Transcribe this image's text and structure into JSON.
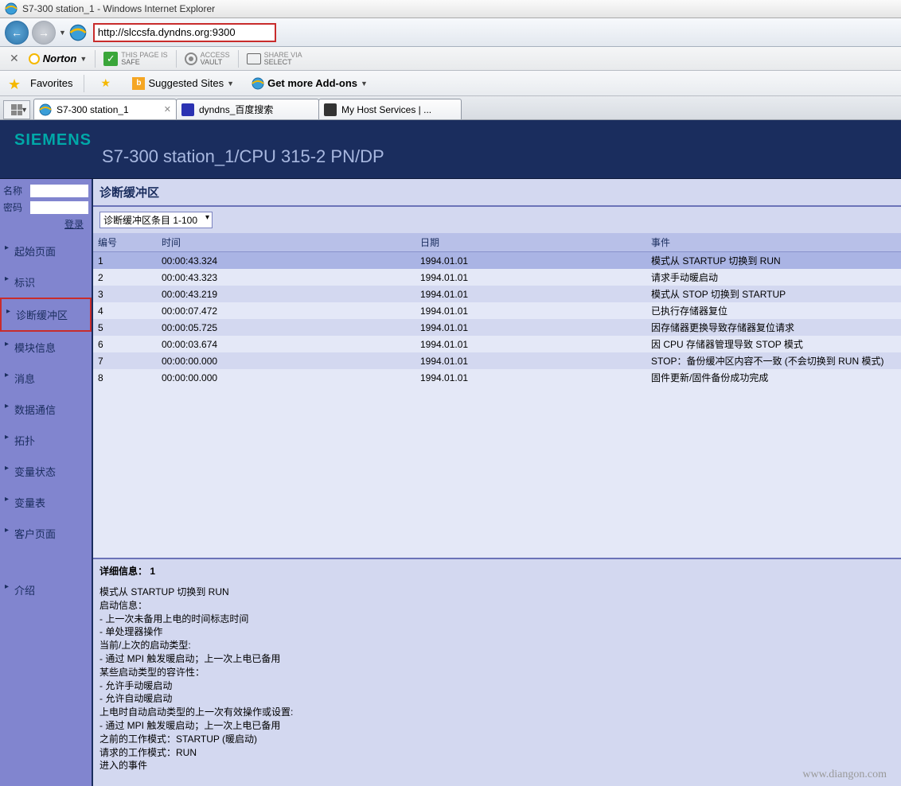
{
  "window": {
    "title": "S7-300 station_1 - Windows Internet Explorer"
  },
  "nav": {
    "url": "http://slccsfa.dyndns.org:9300"
  },
  "norton": {
    "brand": "Norton",
    "safe1": "THIS PAGE IS",
    "safe2": "SAFE",
    "vault1": "ACCESS",
    "vault2": "VAULT",
    "share1": "SHARE VIA",
    "share2": "SELECT"
  },
  "favbar": {
    "favorites": "Favorites",
    "suggested": "Suggested Sites",
    "addons": "Get more Add-ons"
  },
  "tabs": {
    "t1": "S7-300 station_1",
    "t2": "dyndns_百度搜索",
    "t3": "My Host Services | ..."
  },
  "siemens": {
    "logo": "SIEMENS",
    "station": "S7-300 station_1/CPU 315-2 PN/DP"
  },
  "login": {
    "name_label": "名称",
    "pw_label": "密码",
    "login_link": "登录"
  },
  "navitems": {
    "n0": "起始页面",
    "n1": "标识",
    "n2": "诊断缓冲区",
    "n3": "模块信息",
    "n4": "消息",
    "n5": "数据通信",
    "n6": "拓扑",
    "n7": "变量状态",
    "n8": "变量表",
    "n9": "客户页面",
    "n10": "介绍"
  },
  "panel": {
    "title": "诊断缓冲区",
    "dropdown": "诊断缓冲区条目 1-100",
    "col_num": "编号",
    "col_time": "时间",
    "col_date": "日期",
    "col_event": "事件",
    "details_label": "详细信息：   1"
  },
  "rows": [
    {
      "n": "1",
      "t": "00:00:43.324",
      "d": "1994.01.01",
      "e": "模式从 STARTUP 切换到 RUN"
    },
    {
      "n": "2",
      "t": "00:00:43.323",
      "d": "1994.01.01",
      "e": "请求手动暖启动"
    },
    {
      "n": "3",
      "t": "00:00:43.219",
      "d": "1994.01.01",
      "e": "模式从 STOP 切换到 STARTUP"
    },
    {
      "n": "4",
      "t": "00:00:07.472",
      "d": "1994.01.01",
      "e": "已执行存储器复位"
    },
    {
      "n": "5",
      "t": "00:00:05.725",
      "d": "1994.01.01",
      "e": "因存储器更换导致存储器复位请求"
    },
    {
      "n": "6",
      "t": "00:00:03.674",
      "d": "1994.01.01",
      "e": "因 CPU 存储器管理导致 STOP 模式"
    },
    {
      "n": "7",
      "t": "00:00:00.000",
      "d": "1994.01.01",
      "e": "STOP：备份缓冲区内容不一致 (不会切换到 RUN 模式)"
    },
    {
      "n": "8",
      "t": "00:00:00.000",
      "d": "1994.01.01",
      "e": "固件更新/固件备份成功完成"
    }
  ],
  "details": "模式从 STARTUP 切换到 RUN\n启动信息：\n- 上一次未备用上电的时间标志时间\n- 单处理器操作\n当前/上次的启动类型:\n- 通过 MPI 触发暖启动；上一次上电已备用\n某些启动类型的容许性：\n- 允许手动暖启动\n- 允许自动暖启动\n上电时自动启动类型的上一次有效操作或设置:\n- 通过 MPI 触发暖启动；上一次上电已备用\n之前的工作模式：STARTUP (暖启动)\n请求的工作模式：RUN\n进入的事件",
  "watermark": "www.diangon.com"
}
